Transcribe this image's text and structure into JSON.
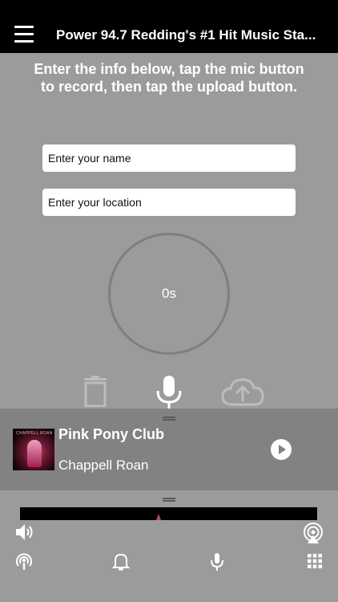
{
  "header": {
    "title": "Power 94.7 Redding's #1 Hit Music Sta..."
  },
  "recorder": {
    "instructions": "Enter the info below, tap the mic button to record, then tap the upload button.",
    "name_placeholder": "Enter your name",
    "location_placeholder": "Enter your location",
    "timer": "0s"
  },
  "now_playing": {
    "title": "Pink Pony Club",
    "artist": "Chappell Roan",
    "art_text": "CHAPPELL ROAN"
  },
  "icons": {
    "menu": "hamburger-menu-icon",
    "trash": "trash-icon",
    "mic": "microphone-icon",
    "upload": "cloud-upload-icon",
    "play": "play-icon",
    "volume": "speaker-icon",
    "airplay": "airplay-icon",
    "podcast": "podcast-icon",
    "bell": "bell-icon",
    "grid": "grid-icon"
  },
  "colors": {
    "header_bg": "#000000",
    "page_bg": "#9b9b9b",
    "player_bg": "#828282"
  }
}
